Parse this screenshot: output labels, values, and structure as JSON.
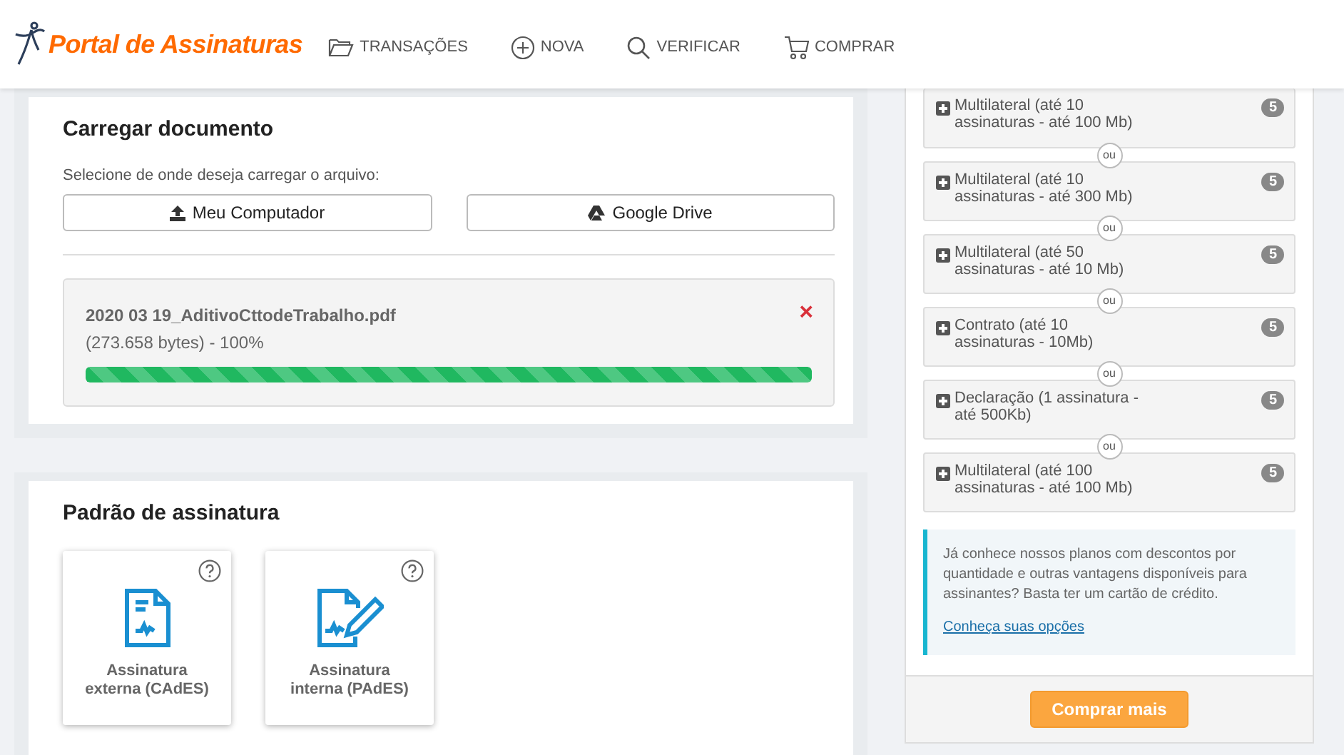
{
  "header": {
    "logo": "Portal de Assinaturas",
    "nav": [
      {
        "kind": "folder",
        "label": "TRANSAÇÕES"
      },
      {
        "kind": "plus",
        "label": "NOVA"
      },
      {
        "kind": "search",
        "label": "VERIFICAR"
      },
      {
        "kind": "cart",
        "label": "COMPRAR"
      }
    ]
  },
  "upload": {
    "title": "Carregar documento",
    "prompt": "Selecione de onde deseja carregar o arquivo:",
    "sources": [
      {
        "kind": "upload",
        "label": "Meu Computador"
      },
      {
        "kind": "drive",
        "label": "Google Drive"
      }
    ],
    "file": {
      "name": "2020 03 19_AditivoCttodeTrabalho.pdf",
      "info": "(273.658 bytes) - 100%",
      "remove": "×",
      "level": 1.0
    }
  },
  "signature": {
    "title": "Padrão de assinatura",
    "options": [
      {
        "kind": "external",
        "label": "Assinatura externa (CAdES)"
      },
      {
        "kind": "internal",
        "label": "Assinatura interna (PAdES)"
      }
    ]
  },
  "plans": {
    "items": [
      {
        "label": "Multilateral (até 10 assinaturas - até 100 Mb)",
        "count": "5"
      },
      {
        "separator": "ou",
        "label": "Multilateral (até 10 assinaturas - até 300 Mb)",
        "count": "5"
      },
      {
        "separator": "ou",
        "label": "Multilateral (até 50 assinaturas - até 10 Mb)",
        "count": "5"
      },
      {
        "separator": "ou",
        "label": "Contrato (até 10 assinaturas - 10Mb)",
        "count": "5"
      },
      {
        "separator": "ou",
        "label": "Declaração (1 assinatura - até 500Kb)",
        "count": "5"
      },
      {
        "separator": "ou",
        "label": "Multilateral (até 100 assinaturas - até 100 Mb)",
        "count": "5"
      }
    ],
    "info": "Já conhece nossos planos com descontos por quantidade e outras vantagens disponíveis para assinantes? Basta ter um cartão de crédito.",
    "link": "Conheça suas opções",
    "button": "Comprar mais"
  }
}
